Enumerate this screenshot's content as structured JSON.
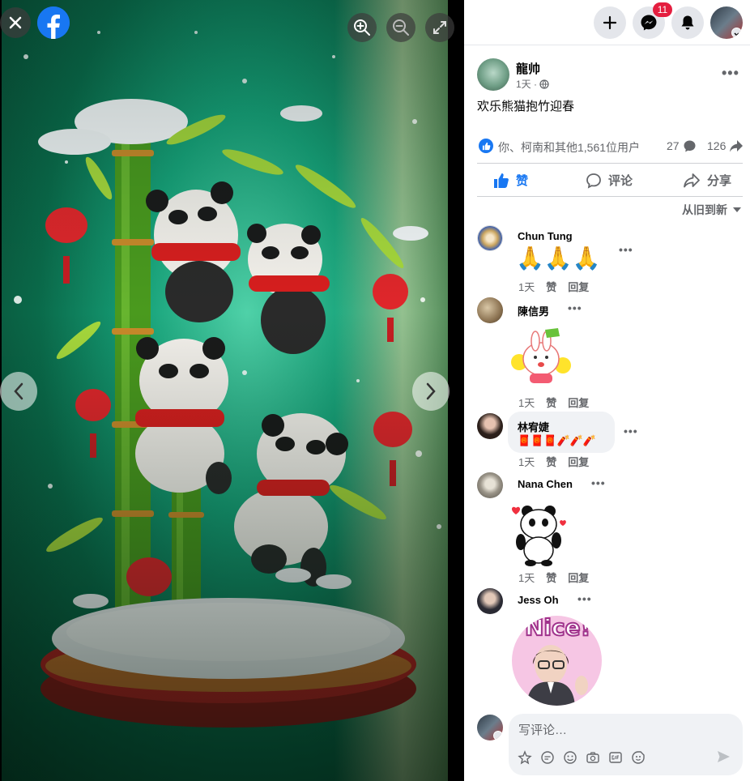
{
  "viewer": {
    "close_icon": "close-icon",
    "logo": "facebook-logo",
    "zoom_in_icon": "zoom-in-icon",
    "zoom_out_icon": "zoom-out-icon",
    "fullscreen_icon": "fullscreen-icon",
    "prev_icon": "chevron-left-icon",
    "next_icon": "chevron-right-icon"
  },
  "topbar": {
    "create_icon": "plus-icon",
    "messenger_icon": "messenger-icon",
    "messenger_badge": "11",
    "notifications_icon": "bell-icon",
    "account_icon": "account-avatar"
  },
  "post": {
    "author": "龍帅",
    "time": "1天 ·",
    "audience_icon": "globe-icon",
    "caption": "欢乐熊猫抱竹迎春",
    "reactions_text": "你、柯南和其他1,561位用户",
    "comments_count": "27",
    "shares_count": "126",
    "actions": {
      "like": "赞",
      "comment": "评论",
      "share": "分享"
    },
    "like_color": "#1877f2",
    "sort_label": "从旧到新"
  },
  "comments": [
    {
      "name": "Chun Tung",
      "body": "🙏🙏🙏",
      "time": "1天",
      "like": "赞",
      "reply": "回复"
    },
    {
      "name": "陳信男",
      "body": "sticker: Go! bunny with pom-poms",
      "time": "1天",
      "like": "赞",
      "reply": "回复"
    },
    {
      "name": "林宥婕",
      "body": "🧧🧧🧧🧨🧨🧨",
      "time": "1天",
      "like": "赞",
      "reply": "回复"
    },
    {
      "name": "Nana Chen",
      "body": "sticker: dancing panda",
      "time": "1天",
      "like": "赞",
      "reply": "回复"
    },
    {
      "name": "Jess Oh",
      "body": "sticker: Nice!",
      "sticker_text": "Nice!",
      "time": "",
      "like": "",
      "reply": ""
    }
  ],
  "composer": {
    "placeholder": "写评论…",
    "tools": [
      "avatar-sticker-icon",
      "comment-sticker-icon",
      "emoji-icon",
      "camera-icon",
      "gif-icon",
      "sticker-icon"
    ],
    "send_icon": "send-icon"
  }
}
